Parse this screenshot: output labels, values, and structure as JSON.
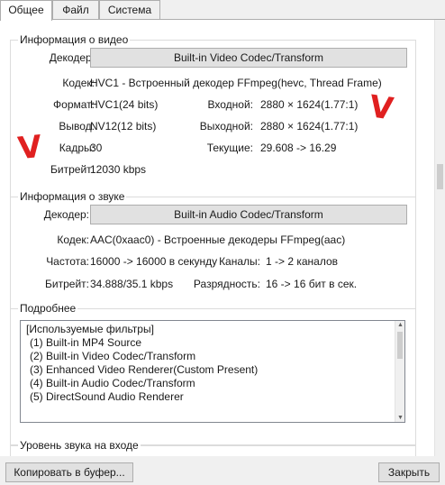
{
  "tabs": [
    {
      "label": "Общее",
      "active": true
    },
    {
      "label": "Файл",
      "active": false
    },
    {
      "label": "Система",
      "active": false
    }
  ],
  "video": {
    "title": "Информация о видео",
    "decoder_label": "Декодер:",
    "decoder_button": "Built-in Video Codec/Transform",
    "codec_label": "Кодек:",
    "codec_value": "HVC1 - Встроенный декодер FFmpeg(hevc, Thread Frame)",
    "format_label": "Формат:",
    "format_value": "HVC1(24 bits)",
    "input_label": "Входной:",
    "input_value": "2880 × 1624(1.77:1)",
    "output_label": "Вывод:",
    "output_value": "NV12(12 bits)",
    "outsize_label": "Выходной:",
    "outsize_value": "2880 × 1624(1.77:1)",
    "frames_label": "Кадры:",
    "frames_value": "30",
    "current_label": "Текущие:",
    "current_value": "29.608 -> 16.29",
    "bitrate_label": "Битрейт:",
    "bitrate_value": "12030 kbps"
  },
  "audio": {
    "title": "Информация о звуке",
    "decoder_label": "Декодер:",
    "decoder_button": "Built-in Audio Codec/Transform",
    "codec_label": "Кодек:",
    "codec_value": "AAC(0xaac0) - Встроенные декодеры FFmpeg(aac)",
    "freq_label": "Частота:",
    "freq_value": "16000 -> 16000 в секунду",
    "channels_label": "Каналы:",
    "channels_value": "1 -> 2 каналов",
    "bitrate_label": "Битрейт:",
    "bitrate_value": "34.888/35.1 kbps",
    "bits_label": "Разрядность:",
    "bits_value": "16 -> 16 бит в сек."
  },
  "details": {
    "title": "Подробнее",
    "lines": [
      "[Используемые фильтры]",
      "(1) Built-in MP4 Source",
      "(2) Built-in Video Codec/Transform",
      "(3) Enhanced Video Renderer(Custom Present)",
      "(4) Built-in Audio Codec/Transform",
      "(5) DirectSound Audio Renderer"
    ]
  },
  "level": {
    "title": "Уровень звука на входе"
  },
  "footer": {
    "copy_button": "Копировать в буфер...",
    "close_button": "Закрыть"
  },
  "annotations": {
    "mark_color": "#e02020",
    "mark_glyph": "V"
  },
  "icons": [
    "scroll-up-arrow-icon",
    "scroll-down-arrow-icon"
  ]
}
